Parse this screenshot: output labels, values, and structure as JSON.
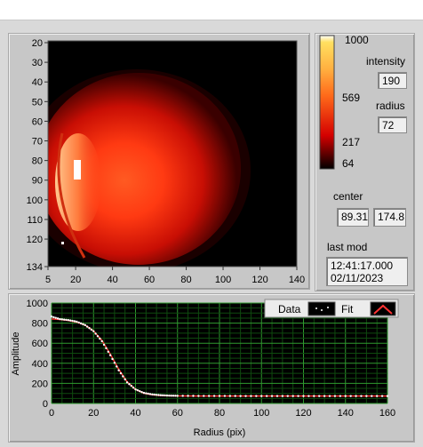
{
  "image_axes": {
    "y_ticks": [
      "20",
      "30",
      "40",
      "50",
      "60",
      "70",
      "80",
      "90",
      "100",
      "110",
      "120",
      "134"
    ],
    "x_ticks": [
      "5",
      "20",
      "40",
      "60",
      "80",
      "100",
      "120",
      "140"
    ]
  },
  "colorbar": {
    "labels": [
      "1000",
      "569",
      "217",
      "64"
    ],
    "colors": {
      "top": "#ffffff",
      "mid": "#ff6a1a",
      "low": "#d40000",
      "bottom": "#000000"
    }
  },
  "intensity": {
    "label": "intensity",
    "value": "190"
  },
  "radius": {
    "label": "radius",
    "value": "72"
  },
  "center": {
    "label": "center",
    "x": "89.31",
    "y": "174.8"
  },
  "last_mod": {
    "label": "last mod",
    "time": "12:41:17.000",
    "date": "02/11/2023"
  },
  "legend": {
    "data_label": "Data",
    "fit_label": "Fit",
    "fit_color": "#ff3333"
  },
  "chart_data": {
    "type": "scatter",
    "xlabel": "Radius (pix)",
    "ylabel": "Amplitude",
    "xlim": [
      0,
      160
    ],
    "ylim": [
      0,
      1000
    ],
    "x_ticks": [
      0,
      20,
      40,
      60,
      80,
      100,
      120,
      140,
      160
    ],
    "y_ticks": [
      0,
      200,
      400,
      600,
      800,
      1000
    ],
    "grid": true,
    "series": [
      {
        "name": "Data",
        "color": "#ffffff",
        "x": [
          0,
          4,
          8,
          12,
          16,
          20,
          24,
          28,
          32,
          36,
          40,
          44,
          48,
          52,
          56,
          60,
          70,
          80,
          90,
          100,
          110,
          120,
          130,
          140,
          150,
          160
        ],
        "y": [
          865,
          840,
          830,
          815,
          780,
          720,
          620,
          480,
          330,
          210,
          140,
          105,
          90,
          82,
          78,
          76,
          75,
          75,
          74,
          74,
          74,
          74,
          74,
          74,
          74,
          74
        ]
      },
      {
        "name": "Fit",
        "color": "#ff3333",
        "x": [
          0,
          4,
          8,
          12,
          16,
          20,
          24,
          28,
          32,
          36,
          40,
          44,
          48,
          52,
          56,
          60,
          70,
          80,
          90,
          100,
          110,
          120,
          130,
          140,
          150,
          160
        ],
        "y": [
          842,
          836,
          826,
          810,
          780,
          722,
          628,
          490,
          340,
          215,
          140,
          102,
          86,
          79,
          76,
          75,
          74,
          74,
          74,
          74,
          74,
          74,
          74,
          74,
          74,
          74
        ]
      }
    ]
  }
}
